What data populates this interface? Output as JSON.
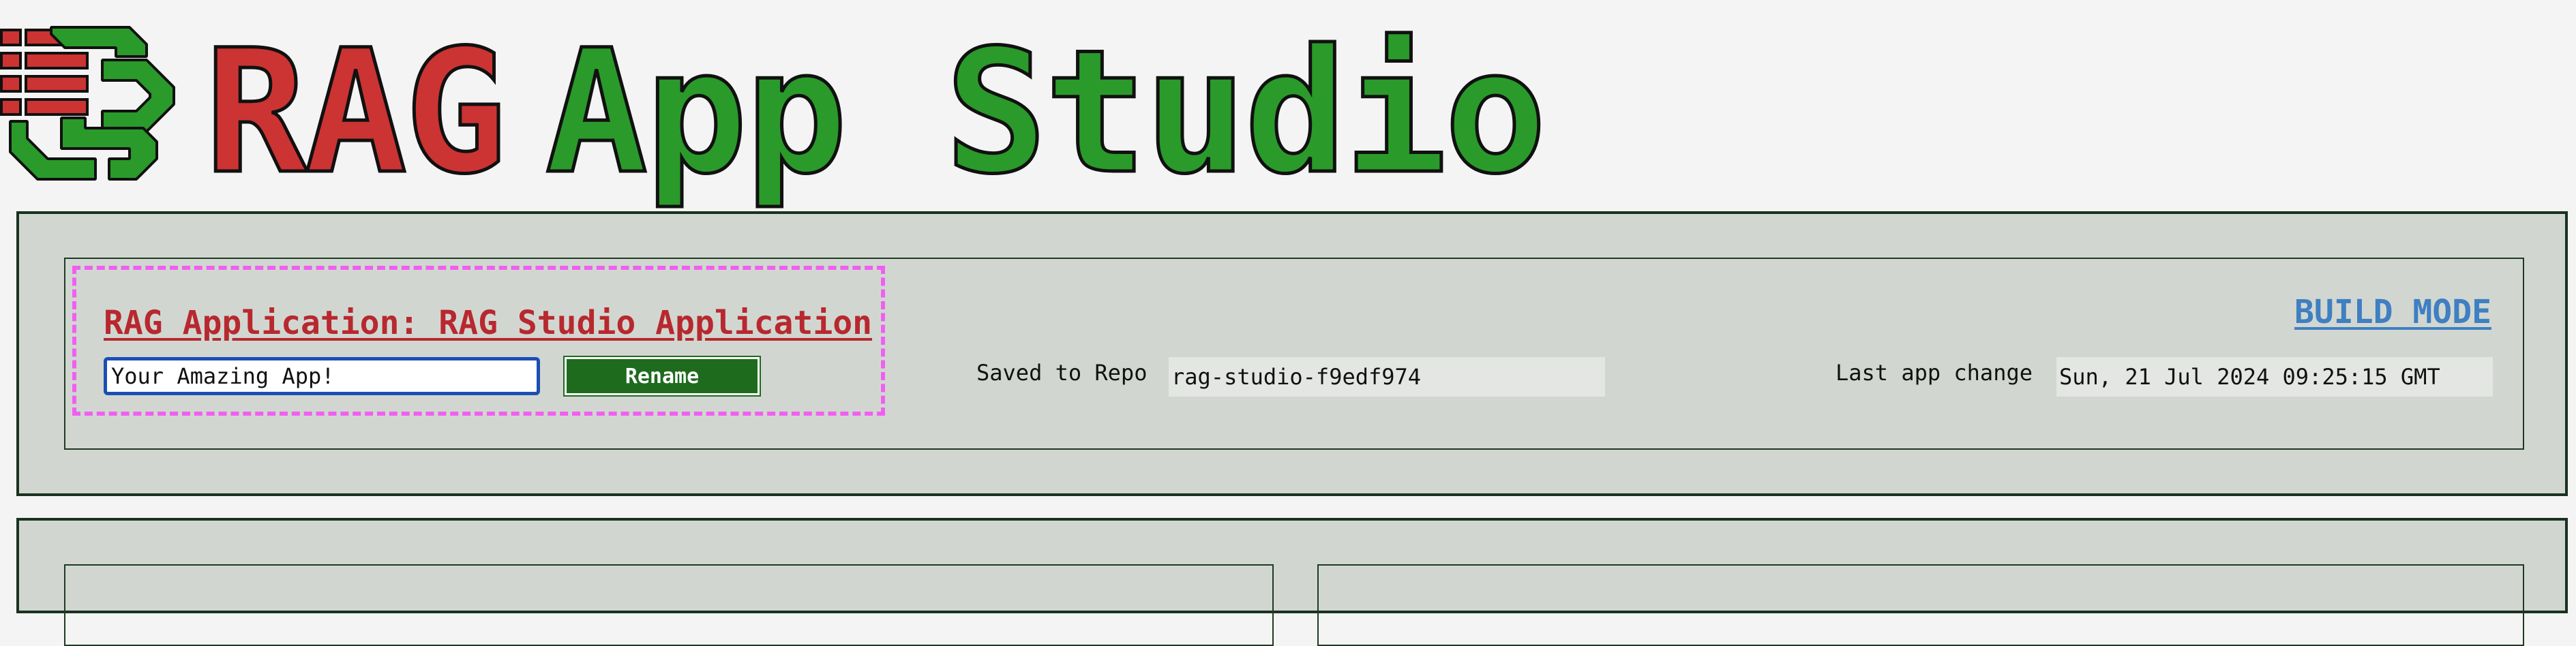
{
  "brand": {
    "word1": "RAG",
    "word2": "App Studio",
    "logo_icon": "rag-network-logo-icon",
    "colors": {
      "red": "#cc3333",
      "green": "#2a9a2a"
    }
  },
  "app": {
    "title": "RAG Application: RAG Studio Application",
    "name_value": "Your Amazing App!",
    "rename_label": "Rename",
    "build_mode_label": "BUILD MODE"
  },
  "repo": {
    "label": "Saved to Repo",
    "value": "rag-studio-f9edf974"
  },
  "last_change": {
    "label": "Last app change",
    "value": "Sun, 21 Jul 2024 09:25:15 GMT"
  },
  "colors": {
    "panel_bg": "#d1d7d0",
    "title_red": "#b8282f",
    "link_blue": "#3f7fc2",
    "button_green": "#1e6b1e",
    "highlight_magenta": "#f15ff1"
  }
}
